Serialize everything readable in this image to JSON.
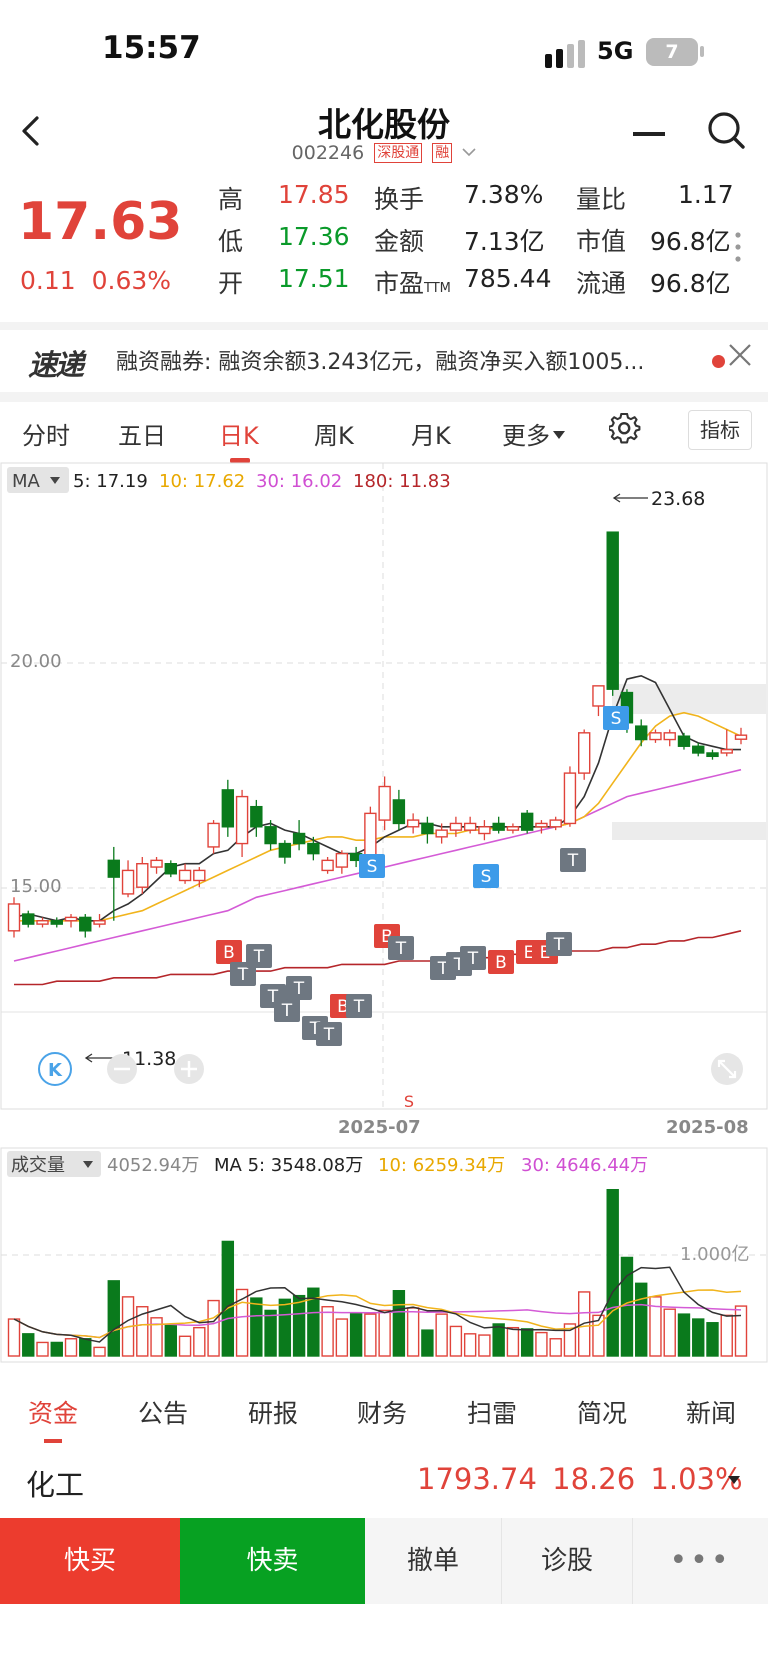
{
  "status": {
    "time": "15:57",
    "network": "5G",
    "battery": "7"
  },
  "header": {
    "name": "北化股份",
    "code": "002246",
    "tag1": "深股通",
    "tag2": "融"
  },
  "quote": {
    "price": "17.63",
    "change": "0.11",
    "change_pct": "0.63%",
    "high_label": "高",
    "high": "17.85",
    "low_label": "低",
    "low": "17.36",
    "open_label": "开",
    "open": "17.51",
    "turnover_label": "换手",
    "turnover": "7.38%",
    "amount_label": "金额",
    "amount": "7.13亿",
    "pe_label": "市盈",
    "pe_sub": "TTM",
    "pe": "785.44",
    "volratio_label": "量比",
    "volratio": "1.17",
    "mcap_label": "市值",
    "mcap": "96.8亿",
    "float_label": "流通",
    "float": "96.8亿"
  },
  "news": {
    "logo": "速递",
    "text": "融资融券: 融资余额3.243亿元，融资净买入额1005..."
  },
  "tabs": {
    "items": [
      "分时",
      "五日",
      "日K",
      "周K",
      "月K",
      "更多"
    ],
    "active": "日K",
    "indicator": "指标"
  },
  "ma_legend": {
    "label": "MA",
    "ma5": "5: 17.19",
    "ma10": "10: 17.62",
    "ma30": "30: 16.02",
    "ma180": "180: 11.83"
  },
  "vol_legend": {
    "label": "成交量",
    "vol": "4052.94万",
    "ma5": "MA 5: 3548.08万",
    "ma10": "10: 6259.34万",
    "ma30": "30: 4646.44万"
  },
  "colors": {
    "up": "#e0433a",
    "down": "#0a7a1c",
    "ma5": "#333333",
    "ma10": "#f1b41c",
    "ma30": "#d45bd6",
    "ma180": "#b5262a"
  },
  "chart_data": {
    "type": "candlestick",
    "y_ticks": [
      "20.00",
      "15.00"
    ],
    "ylim": [
      9.5,
      24.4
    ],
    "x_ticks": [
      {
        "index": 23,
        "label": "2025-07"
      },
      {
        "index": 46,
        "label": "2025-08"
      }
    ],
    "annotations": {
      "high": "23.68",
      "low": "11.38"
    },
    "candles": [
      {
        "o": 11.8,
        "c": 12.6,
        "h": 12.8,
        "l": 11.6
      },
      {
        "o": 12.3,
        "c": 12.0,
        "h": 12.4,
        "l": 11.9
      },
      {
        "o": 12.0,
        "c": 12.1,
        "h": 12.2,
        "l": 11.9
      },
      {
        "o": 12.1,
        "c": 12.0,
        "h": 12.2,
        "l": 11.9
      },
      {
        "o": 12.1,
        "c": 12.2,
        "h": 12.3,
        "l": 11.9
      },
      {
        "o": 12.2,
        "c": 11.8,
        "h": 12.3,
        "l": 11.6
      },
      {
        "o": 12.0,
        "c": 12.1,
        "h": 12.3,
        "l": 11.9
      },
      {
        "o": 13.9,
        "c": 13.4,
        "h": 14.3,
        "l": 12.1
      },
      {
        "o": 12.9,
        "c": 13.6,
        "h": 13.9,
        "l": 12.8
      },
      {
        "o": 13.1,
        "c": 13.8,
        "h": 14.0,
        "l": 12.9
      },
      {
        "o": 13.7,
        "c": 13.9,
        "h": 14.0,
        "l": 13.5
      },
      {
        "o": 13.8,
        "c": 13.5,
        "h": 13.9,
        "l": 13.4
      },
      {
        "o": 13.3,
        "c": 13.6,
        "h": 13.8,
        "l": 13.2
      },
      {
        "o": 13.3,
        "c": 13.6,
        "h": 13.7,
        "l": 13.1
      },
      {
        "o": 14.3,
        "c": 15.0,
        "h": 15.1,
        "l": 14.1
      },
      {
        "o": 16.0,
        "c": 14.9,
        "h": 16.3,
        "l": 14.6
      },
      {
        "o": 14.4,
        "c": 15.8,
        "h": 16.0,
        "l": 14.0
      },
      {
        "o": 15.5,
        "c": 14.9,
        "h": 15.7,
        "l": 14.6
      },
      {
        "o": 14.9,
        "c": 14.4,
        "h": 15.1,
        "l": 14.2
      },
      {
        "o": 14.4,
        "c": 14.0,
        "h": 14.5,
        "l": 13.8
      },
      {
        "o": 14.7,
        "c": 14.4,
        "h": 15.1,
        "l": 14.2
      },
      {
        "o": 14.4,
        "c": 14.1,
        "h": 14.6,
        "l": 13.9
      },
      {
        "o": 13.6,
        "c": 13.9,
        "h": 14.0,
        "l": 13.5
      },
      {
        "o": 13.7,
        "c": 14.1,
        "h": 14.2,
        "l": 13.5
      },
      {
        "o": 14.1,
        "c": 13.9,
        "h": 14.3,
        "l": 13.7
      },
      {
        "o": 14.0,
        "c": 15.3,
        "h": 15.5,
        "l": 13.9
      },
      {
        "o": 15.1,
        "c": 16.1,
        "h": 16.4,
        "l": 14.8
      },
      {
        "o": 15.7,
        "c": 15.0,
        "h": 16.0,
        "l": 14.8
      },
      {
        "o": 14.9,
        "c": 15.1,
        "h": 15.3,
        "l": 14.7
      },
      {
        "o": 15.0,
        "c": 14.7,
        "h": 15.2,
        "l": 14.4
      },
      {
        "o": 14.6,
        "c": 14.8,
        "h": 15.0,
        "l": 14.4
      },
      {
        "o": 14.8,
        "c": 15.0,
        "h": 15.2,
        "l": 14.6
      },
      {
        "o": 14.8,
        "c": 15.0,
        "h": 15.2,
        "l": 14.7
      },
      {
        "o": 14.7,
        "c": 14.9,
        "h": 15.1,
        "l": 14.5
      },
      {
        "o": 15.0,
        "c": 14.8,
        "h": 15.2,
        "l": 14.7
      },
      {
        "o": 14.8,
        "c": 14.9,
        "h": 15.0,
        "l": 14.7
      },
      {
        "o": 15.3,
        "c": 14.8,
        "h": 15.4,
        "l": 14.7
      },
      {
        "o": 14.9,
        "c": 15.0,
        "h": 15.1,
        "l": 14.7
      },
      {
        "o": 14.9,
        "c": 15.1,
        "h": 15.2,
        "l": 14.8
      },
      {
        "o": 15.0,
        "c": 16.5,
        "h": 16.7,
        "l": 14.9
      },
      {
        "o": 16.5,
        "c": 17.7,
        "h": 17.8,
        "l": 16.3
      },
      {
        "o": 18.5,
        "c": 19.1,
        "h": 19.1,
        "l": 18.2
      },
      {
        "o": 23.68,
        "c": 19.0,
        "h": 23.68,
        "l": 18.8
      },
      {
        "o": 18.9,
        "c": 18.0,
        "h": 19.0,
        "l": 17.7
      },
      {
        "o": 17.9,
        "c": 17.5,
        "h": 18.1,
        "l": 17.3
      },
      {
        "o": 17.5,
        "c": 17.7,
        "h": 17.8,
        "l": 17.4
      },
      {
        "o": 17.5,
        "c": 17.7,
        "h": 17.8,
        "l": 17.3
      },
      {
        "o": 17.6,
        "c": 17.3,
        "h": 17.7,
        "l": 17.2
      },
      {
        "o": 17.3,
        "c": 17.1,
        "h": 17.4,
        "l": 17.0
      },
      {
        "o": 17.1,
        "c": 17.0,
        "h": 17.2,
        "l": 16.9
      },
      {
        "o": 17.1,
        "c": 17.2,
        "h": 17.8,
        "l": 17.0
      },
      {
        "o": 17.51,
        "c": 17.63,
        "h": 17.85,
        "l": 17.36
      }
    ],
    "ma5": [
      12.2,
      12.3,
      12.2,
      12.1,
      12.2,
      12.1,
      12.1,
      12.4,
      12.6,
      12.9,
      13.3,
      13.7,
      13.8,
      13.8,
      14.1,
      14.2,
      14.6,
      14.9,
      15.0,
      14.8,
      14.7,
      14.5,
      14.3,
      14.1,
      14.1,
      14.3,
      14.6,
      14.8,
      15.0,
      15.0,
      14.9,
      14.9,
      14.9,
      14.9,
      14.9,
      14.9,
      14.9,
      14.9,
      14.9,
      15.2,
      15.8,
      16.8,
      18.2,
      19.3,
      19.4,
      19.2,
      18.4,
      17.6,
      17.4,
      17.3,
      17.2,
      17.2
    ],
    "ma10": [
      12.1,
      12.1,
      12.1,
      12.1,
      12.1,
      12.1,
      12.1,
      12.2,
      12.3,
      12.4,
      12.6,
      12.8,
      13.0,
      13.2,
      13.4,
      13.6,
      13.8,
      14.0,
      14.2,
      14.3,
      14.4,
      14.5,
      14.6,
      14.6,
      14.5,
      14.5,
      14.6,
      14.6,
      14.6,
      14.7,
      14.7,
      14.7,
      14.8,
      14.8,
      14.9,
      14.9,
      14.9,
      14.9,
      14.9,
      15.0,
      15.2,
      15.6,
      16.2,
      16.8,
      17.4,
      17.9,
      18.2,
      18.3,
      18.2,
      18.0,
      17.8,
      17.6
    ],
    "ma30": [
      10.9,
      11.0,
      11.1,
      11.2,
      11.3,
      11.4,
      11.5,
      11.6,
      11.7,
      11.8,
      11.9,
      12.0,
      12.1,
      12.2,
      12.3,
      12.4,
      12.6,
      12.8,
      12.9,
      13.0,
      13.1,
      13.2,
      13.3,
      13.4,
      13.5,
      13.6,
      13.7,
      13.8,
      13.9,
      14.0,
      14.1,
      14.2,
      14.3,
      14.4,
      14.5,
      14.6,
      14.7,
      14.8,
      14.9,
      15.0,
      15.2,
      15.4,
      15.6,
      15.8,
      15.9,
      16.0,
      16.1,
      16.2,
      16.3,
      16.4,
      16.5,
      16.6
    ],
    "ma180": [
      10.2,
      10.2,
      10.2,
      10.3,
      10.3,
      10.3,
      10.3,
      10.4,
      10.4,
      10.4,
      10.4,
      10.5,
      10.5,
      10.5,
      10.5,
      10.6,
      10.6,
      10.6,
      10.6,
      10.7,
      10.7,
      10.7,
      10.7,
      10.8,
      10.8,
      10.8,
      10.8,
      10.9,
      10.9,
      10.9,
      10.9,
      11.0,
      11.0,
      11.0,
      11.0,
      11.1,
      11.1,
      11.1,
      11.1,
      11.2,
      11.2,
      11.2,
      11.3,
      11.3,
      11.4,
      11.4,
      11.5,
      11.5,
      11.6,
      11.6,
      11.7,
      11.8
    ],
    "volume_unit": "万",
    "volume_tick": "1.000亿",
    "volume": [
      3000,
      1800,
      1100,
      1100,
      1400,
      1400,
      700,
      6100,
      4800,
      4000,
      3100,
      2500,
      1600,
      2300,
      4500,
      9300,
      5400,
      4700,
      3700,
      4600,
      4900,
      5500,
      4000,
      3000,
      3500,
      3400,
      3700,
      5300,
      3900,
      2100,
      3400,
      2400,
      1800,
      1700,
      2600,
      2300,
      2200,
      1900,
      1400,
      2600,
      5200,
      3300,
      13500,
      8000,
      5900,
      4800,
      3800,
      3400,
      3000,
      2700,
      3300,
      4053
    ]
  },
  "bottom_tabs": {
    "items": [
      "资金",
      "公告",
      "研报",
      "财务",
      "扫雷",
      "简况",
      "新闻"
    ],
    "active": "资金"
  },
  "industry": {
    "name": "化工",
    "index": "1793.74",
    "change": "18.26",
    "pct": "1.03%"
  },
  "actions": {
    "buy": "快买",
    "sell": "快卖",
    "cancel": "撤单",
    "diagnose": "诊股",
    "more": "•••"
  }
}
